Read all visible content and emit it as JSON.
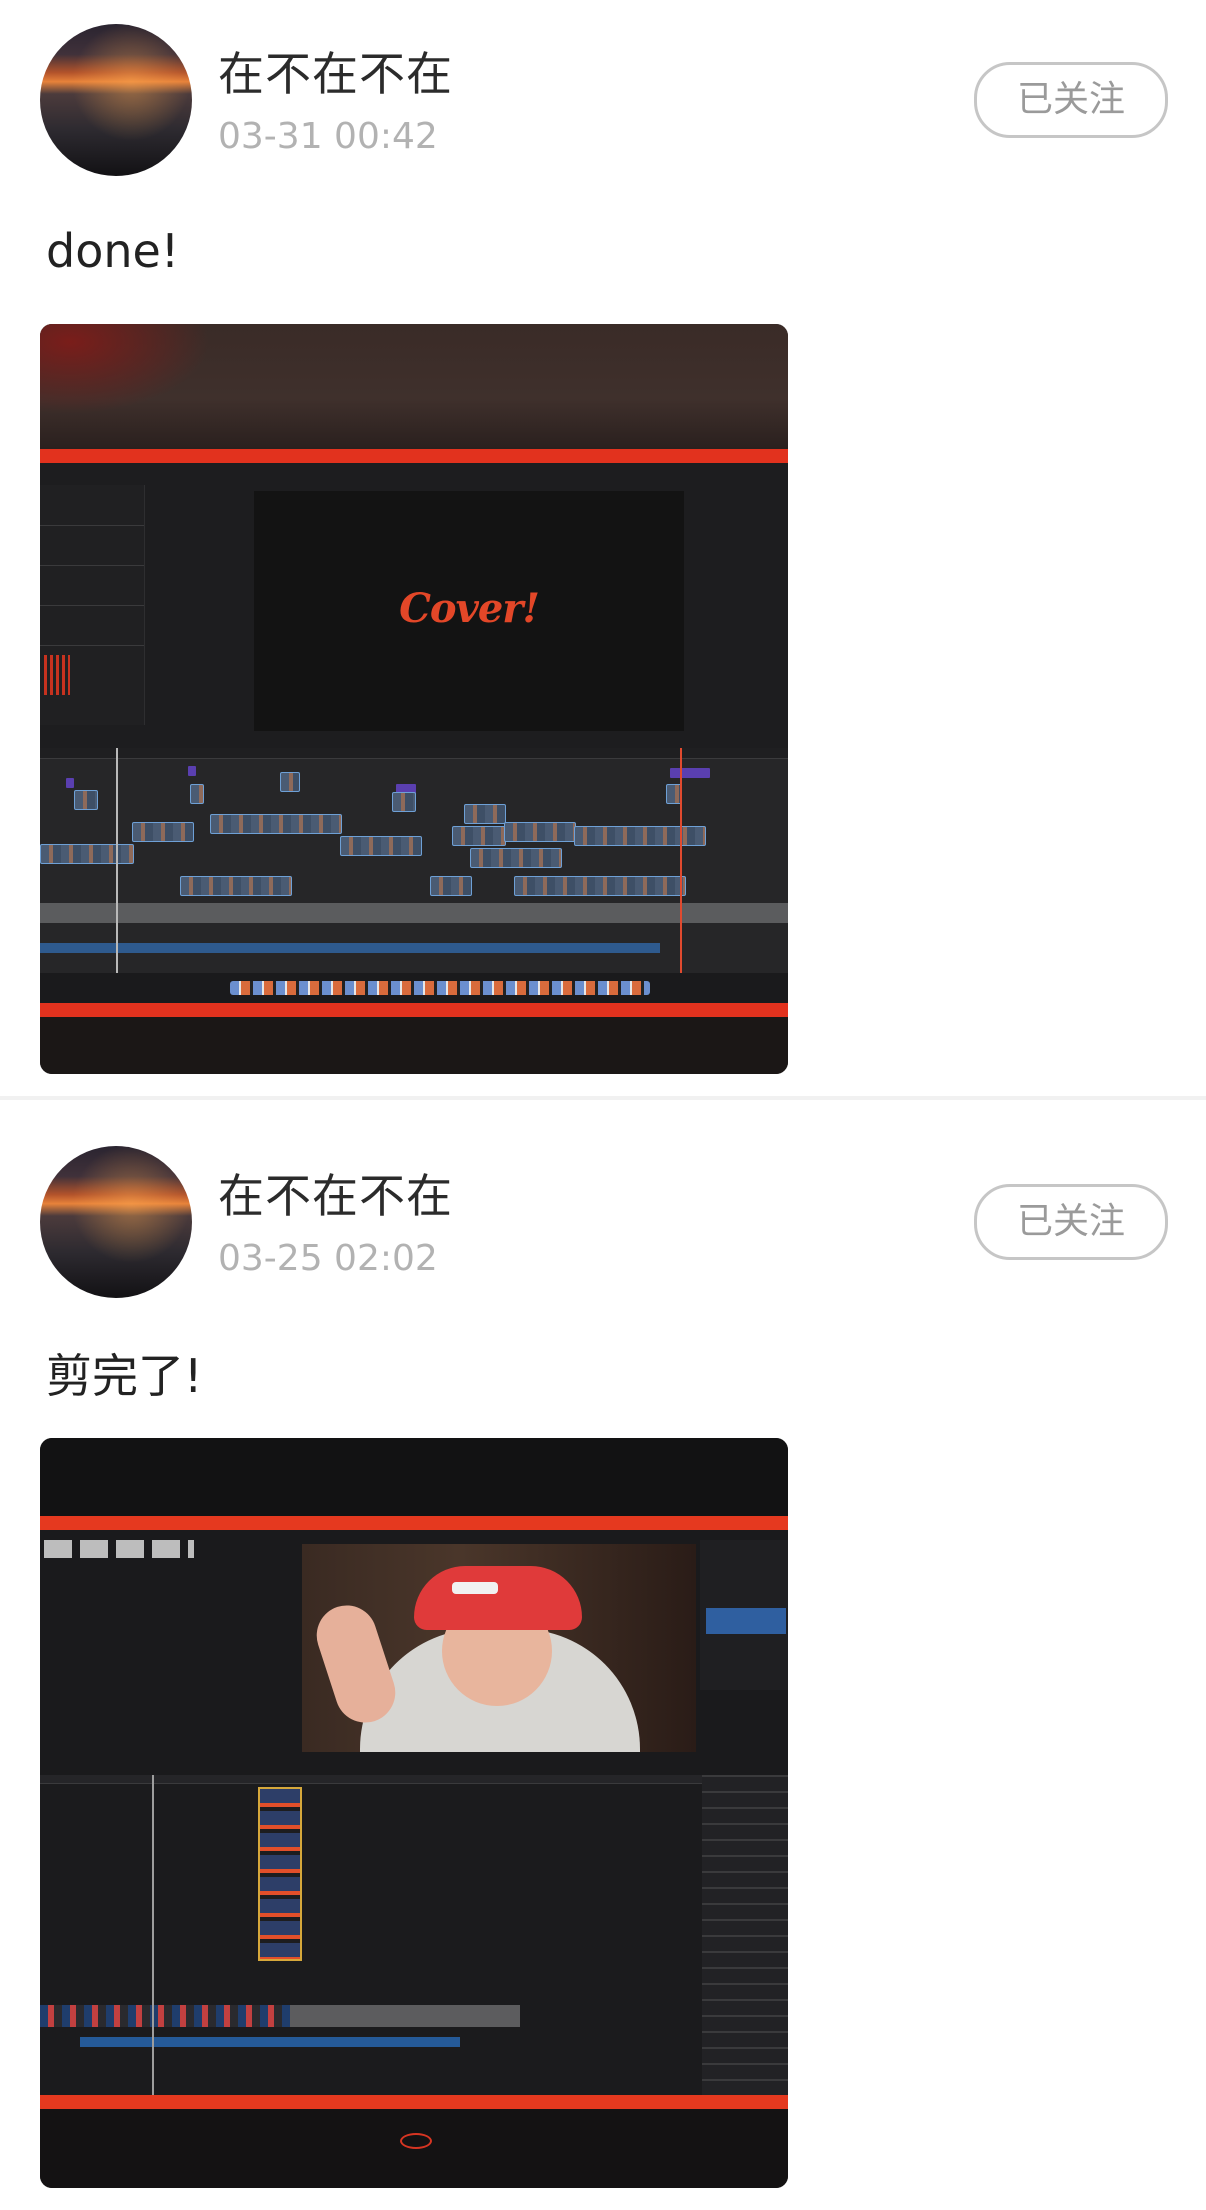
{
  "posts": [
    {
      "username": "在不在不在",
      "time": "03-31 00:42",
      "follow_label": "已关注",
      "text": "done!",
      "image": {
        "overlay_text": "Cover!"
      }
    },
    {
      "username": "在不在不在",
      "time": "03-25 02:02",
      "follow_label": "已关注",
      "text": "剪完了!",
      "image": {}
    }
  ]
}
